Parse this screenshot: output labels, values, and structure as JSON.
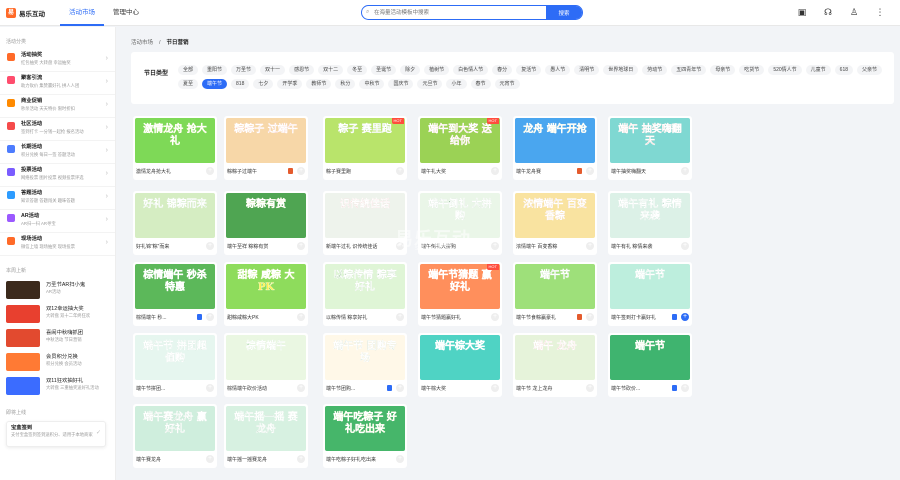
{
  "header": {
    "logo_mark": "易",
    "logo_text": "易乐互动",
    "nav": [
      {
        "label": "活动市场",
        "active": true
      },
      {
        "label": "管理中心",
        "active": false
      }
    ],
    "search_placeholder": "在海量活动模板中搜索",
    "search_button": "搜索",
    "icons": [
      "briefcase-icon",
      "headset-icon",
      "user-icon",
      "more-icon"
    ]
  },
  "sidebar": {
    "section1_title": "活动分类",
    "items": [
      {
        "title": "活动抽奖",
        "desc": "红包抽奖  大转盘  幸运抽奖",
        "color": "#ff6a28"
      },
      {
        "title": "聚客引流",
        "desc": "助力砍价  集赞赢好礼  拼人人团",
        "color": "#ff4d6d"
      },
      {
        "title": "商业促销",
        "desc": "秒杀活动  天天特价  限时折扣",
        "color": "#ff8a00"
      },
      {
        "title": "社区活动",
        "desc": "签到打卡  一分钱一起抢  报名活动",
        "color": "#f54b4b"
      },
      {
        "title": "长期活动",
        "desc": "积分兑换  每日一签  答题活动",
        "color": "#4d7cfe"
      },
      {
        "title": "投票活动",
        "desc": "网络投票  图片投票  视频投票评选",
        "color": "#7a5cff"
      },
      {
        "title": "答题活动",
        "desc": "知识答题  答题闯关  趣味答题",
        "color": "#2d9cff"
      },
      {
        "title": "AR活动",
        "desc": "AR扫一扫  AR寻宝",
        "color": "#9b59ff"
      },
      {
        "title": "现场活动",
        "desc": "微信上墙  现场抽奖  现场投票",
        "color": "#ff6a28"
      }
    ],
    "section2_title": "本周上新",
    "recent": [
      {
        "title": "万圣节AR扫小鬼",
        "desc": "AR活动",
        "color": "#3b2a1c"
      },
      {
        "title": "双12幸运抽大奖",
        "desc": "大转盘  双十二年终狂欢",
        "color": "#e8402f"
      },
      {
        "title": "喜闹中秋嗨抓团",
        "desc": "中秋活动  节日营销",
        "color": "#e24a2f"
      },
      {
        "title": "会员积分兑换",
        "desc": "积分兑换  会员活动",
        "color": "#ff7a34"
      },
      {
        "title": "双11狂欢抽好礼",
        "desc": "大转盘  三重抽奖送好礼活动",
        "color": "#3b6cff"
      }
    ],
    "section3_title": "即将上线",
    "bottom_card": {
      "title": "宝盒签到",
      "desc": "支付宝盒签到签到送积分、适用于本地商家",
      "ok": "✓"
    }
  },
  "breadcrumb": {
    "root": "活动市场",
    "sep": "/",
    "current": "节日营销"
  },
  "filter": {
    "label": "节日类型",
    "tags": [
      "全部",
      "重阳节",
      "万圣节",
      "双十一",
      "感恩节",
      "双十二",
      "冬至",
      "圣诞节",
      "除夕",
      "植树节",
      "白色情人节",
      "春分",
      "复活节",
      "愚人节",
      "清明节",
      "世界地球日",
      "劳动节",
      "五四青年节",
      "母亲节",
      "吃货节",
      "520情人节",
      "儿童节",
      "618",
      "父亲节",
      "夏至",
      "端午节",
      "818",
      "七夕",
      "开学季",
      "教师节",
      "秋分",
      "中秋节",
      "国庆节",
      "元旦节",
      "小年",
      "春节",
      "元宵节"
    ],
    "selected": "端午节"
  },
  "cards": [
    {
      "name": "激情龙舟抢大礼",
      "art": "激情龙舟 抢大礼",
      "bg": "#7ed957",
      "fg": "#ffde3b",
      "hot": false,
      "badge": "",
      "add_on": false
    },
    {
      "name": "粽粽子过端午",
      "art": "粽粽子 过端午",
      "bg": "#f7d7a8",
      "fg": "#e7352b",
      "hot": false,
      "badge": "#e45b2d",
      "add_on": false
    },
    {
      "name": "粽子赛里跑",
      "art": "粽子 赛里跑",
      "bg": "#b9e46b",
      "fg": "#2f8a2f",
      "hot": true,
      "badge": "",
      "add_on": false
    },
    {
      "name": "端午礼大奖",
      "art": "端午到大奖 送给你",
      "bg": "#9bd255",
      "fg": "#e73a2a",
      "hot": true,
      "badge": "",
      "add_on": false
    },
    {
      "name": "端午龙舟赛",
      "art": "龙舟 端午开抢",
      "bg": "#4aa6ef",
      "fg": "#ffe13a",
      "hot": false,
      "badge": "#e45b2d",
      "add_on": false
    },
    {
      "name": "端午抽奖嗨翻天",
      "art": "端午 抽奖嗨翻天",
      "bg": "#7fd8d2",
      "fg": "#e8452a",
      "hot": false,
      "badge": "",
      "add_on": false
    },
    {
      "name": "好礼锦“粽”而来",
      "art": "好礼 锦粽而来",
      "bg": "#d5edc2",
      "fg": "#3d9a3a",
      "hot": false,
      "badge": "",
      "add_on": false
    },
    {
      "name": "端午至祥 粽粽有赏",
      "art": "粽粽有赏",
      "bg": "#4fa552",
      "fg": "#ffe25c",
      "hot": false,
      "badge": "",
      "add_on": false
    },
    {
      "name": "新端午过礼 识传统佳话",
      "art": "识传统佳话",
      "bg": "#eef3ec",
      "fg": "#c33a33",
      "hot": false,
      "badge": "",
      "add_on": false
    },
    {
      "name": "端午倒礼大拼购",
      "art": "端午倒礼 大拼购",
      "bg": "#eaf6e8",
      "fg": "#2d7b3a",
      "hot": false,
      "badge": "",
      "add_on": false
    },
    {
      "name": "浓情端午 百变香粽",
      "art": "浓情端午 百变香粽",
      "bg": "#f9e3a0",
      "fg": "#c44a2a",
      "hot": false,
      "badge": "",
      "add_on": false
    },
    {
      "name": "端午有礼 粽情来袭",
      "art": "端午有礼 粽情来袭",
      "bg": "#dcf1e7",
      "fg": "#2f8a5a",
      "hot": false,
      "badge": "",
      "add_on": false
    },
    {
      "name": "棕情端午 秒...",
      "art": "棕情端午 秒杀特惠",
      "bg": "#5cb85a",
      "fg": "#fff",
      "hot": false,
      "badge": "#2d6cf6",
      "add_on": false
    },
    {
      "name": "甜粽咸粽大PK",
      "art": "甜粽 咸粽 大PK",
      "bg": "#8edc5c",
      "fg": "#fff04a",
      "hot": false,
      "badge": "",
      "add_on": false
    },
    {
      "name": "以粽传情 粽享好礼",
      "art": "以粽传情 粽享好礼",
      "bg": "#dff5d6",
      "fg": "#2e7d32",
      "hot": false,
      "badge": "",
      "add_on": false
    },
    {
      "name": "端午节猜题赢好礼",
      "art": "端午节猜题 赢好礼",
      "bg": "#ff8f5c",
      "fg": "#fff",
      "hot": true,
      "badge": "",
      "add_on": false
    },
    {
      "name": "端午节食粽赢豪礼",
      "art": "端午节",
      "bg": "#9ee07a",
      "fg": "#2d7a2a",
      "hot": false,
      "badge": "#e45b2d",
      "add_on": false
    },
    {
      "name": "端午签到打卡赢好礼",
      "art": "端午节",
      "bg": "#bdeedd",
      "fg": "#27a36f",
      "hot": false,
      "badge": "#2d6cf6",
      "add_on": true
    },
    {
      "name": "端午节拼团...",
      "art": "端午节 拼团超值购",
      "bg": "#e6f6ef",
      "fg": "#2c8a56",
      "hot": false,
      "badge": "",
      "add_on": false
    },
    {
      "name": "棕情端午砍价活动",
      "art": "棕情端午",
      "bg": "#eaf7e2",
      "fg": "#3ba23a",
      "hot": false,
      "badge": "",
      "add_on": false
    },
    {
      "name": "端午节团购...",
      "art": "端午节 团购专场",
      "bg": "#fff8e8",
      "fg": "#3d7a3a",
      "hot": false,
      "badge": "#2d6cf6",
      "add_on": false
    },
    {
      "name": "端午棕大奖",
      "art": "端午棕大奖",
      "bg": "#4fd3c4",
      "fg": "#fff",
      "hot": false,
      "badge": "",
      "add_on": false
    },
    {
      "name": "端午节 龙上龙舟",
      "art": "端午 龙舟",
      "bg": "#e6f3da",
      "fg": "#d83b2e",
      "hot": false,
      "badge": "",
      "add_on": false
    },
    {
      "name": "端午节砍价...",
      "art": "端午节",
      "bg": "#3fb46f",
      "fg": "#ffe55a",
      "hot": false,
      "badge": "#2d6cf6",
      "add_on": false
    },
    {
      "name": "端午赛龙舟",
      "art": "端午赛龙舟 赢好礼",
      "bg": "#cfeedd",
      "fg": "#2b7a3a",
      "hot": false,
      "badge": "",
      "add_on": false
    },
    {
      "name": "端午摇一摇赛龙舟",
      "art": "端午摇一摇 赛龙舟",
      "bg": "#d7f1e1",
      "fg": "#2f8a4a",
      "hot": false,
      "badge": "",
      "add_on": false
    },
    {
      "name": "端午吃粽子好礼吃出来",
      "art": "端午吃粽子 好礼吃出来",
      "bg": "#46b66a",
      "fg": "#fff04a",
      "hot": false,
      "badge": "",
      "add_on": false
    }
  ],
  "watermark": {
    "text": "易乐互动",
    "sub": "SHANGOU  WEB"
  }
}
